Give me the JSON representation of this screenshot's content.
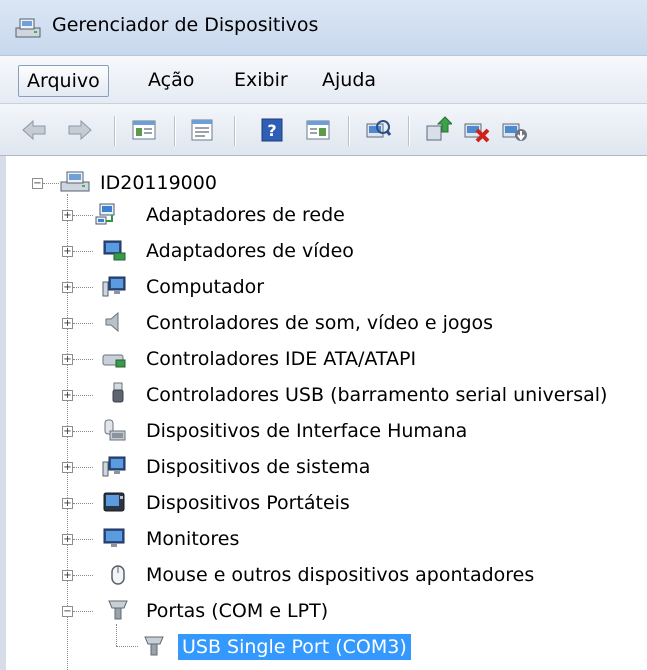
{
  "window": {
    "title": "Gerenciador de Dispositivos"
  },
  "menu": {
    "items": [
      "Arquivo",
      "Ação",
      "Exibir",
      "Ajuda"
    ]
  },
  "toolbar": {
    "icons": [
      "back-arrow-icon",
      "forward-arrow-icon",
      "show-hide-tree-icon",
      "properties-icon",
      "help-icon",
      "action-pane-icon",
      "scan-hardware-icon",
      "update-driver-icon",
      "uninstall-icon",
      "disable-device-icon"
    ]
  },
  "tree": {
    "root": {
      "label": "ID20119000",
      "expanded": true
    },
    "categories": [
      {
        "label": "Adaptadores de rede",
        "icon": "network-adapter-icon",
        "expanded": false
      },
      {
        "label": "Adaptadores de vídeo",
        "icon": "display-adapter-icon",
        "expanded": false
      },
      {
        "label": "Computador",
        "icon": "computer-icon",
        "expanded": false
      },
      {
        "label": "Controladores de som, vídeo e jogos",
        "icon": "speaker-icon",
        "expanded": false
      },
      {
        "label": "Controladores IDE ATA/ATAPI",
        "icon": "ide-controller-icon",
        "expanded": false
      },
      {
        "label": "Controladores USB (barramento serial universal)",
        "icon": "usb-connector-icon",
        "expanded": false
      },
      {
        "label": "Dispositivos de Interface Humana",
        "icon": "hid-icon",
        "expanded": false
      },
      {
        "label": "Dispositivos de sistema",
        "icon": "system-device-icon",
        "expanded": false
      },
      {
        "label": "Dispositivos Portáteis",
        "icon": "portable-device-icon",
        "expanded": false
      },
      {
        "label": "Monitores",
        "icon": "monitor-icon",
        "expanded": false
      },
      {
        "label": "Mouse e outros dispositivos apontadores",
        "icon": "mouse-icon",
        "expanded": false
      },
      {
        "label": "Portas (COM e LPT)",
        "icon": "port-connector-icon",
        "expanded": true
      }
    ],
    "child": {
      "label": "USB Single Port (COM3)",
      "icon": "port-connector-icon",
      "selected": true
    }
  }
}
